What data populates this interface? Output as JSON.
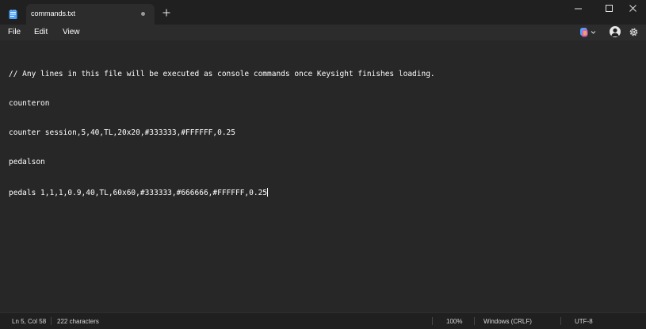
{
  "tab": {
    "title": "commands.txt"
  },
  "menu": {
    "file": "File",
    "edit": "Edit",
    "view": "View"
  },
  "editor": {
    "lines": [
      "// Any lines in this file will be executed as console commands once Keysight finishes loading.",
      "counteron",
      "counter session,5,40,TL,20x20,#333333,#FFFFFF,0.25",
      "pedalson",
      "pedals 1,1,1,0.9,40,TL,60x60,#333333,#666666,#FFFFFF,0.25"
    ]
  },
  "status": {
    "position": "Ln 5, Col 58",
    "characters": "222 characters",
    "zoom": "100%",
    "line_ending": "Windows (CRLF)",
    "encoding": "UTF-8"
  },
  "icons": {
    "app": "notepad-icon",
    "close_tab": "tab-close-dot-icon",
    "new_tab": "plus-icon",
    "copilot": "copilot-icon",
    "account": "account-avatar-icon",
    "settings": "gear-icon"
  },
  "colors": {
    "titlebar": "#202020",
    "editor_bg": "#272727",
    "text": "#FFFFFF",
    "accent_icon": "#4aa3ff"
  }
}
